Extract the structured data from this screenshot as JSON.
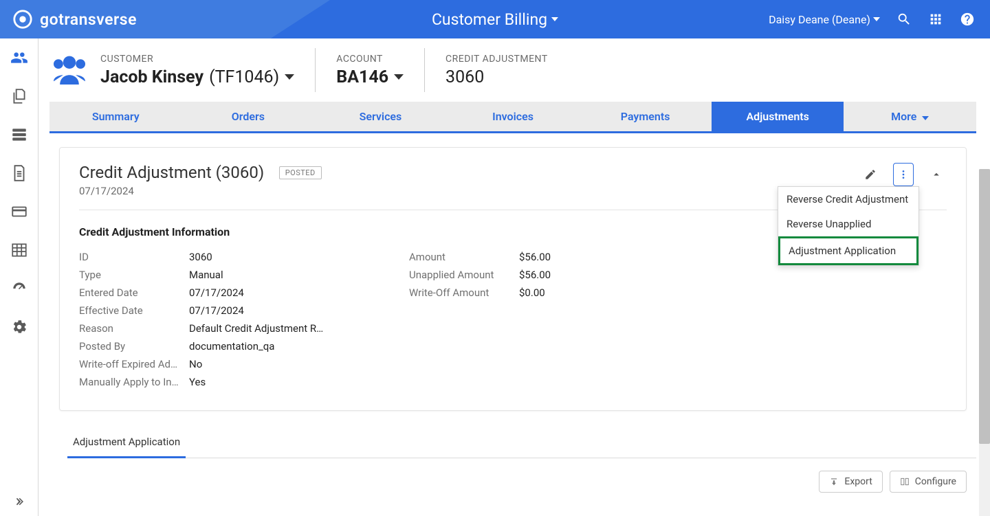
{
  "app": {
    "name": "gotransverse",
    "module": "Customer Billing"
  },
  "user": {
    "display": "Daisy Deane (Deane)"
  },
  "breadcrumb": {
    "customer": {
      "label": "CUSTOMER",
      "name": "Jacob Kinsey",
      "ref": "(TF1046)"
    },
    "account": {
      "label": "ACCOUNT",
      "value": "BA146"
    },
    "credit_adjustment": {
      "label": "CREDIT ADJUSTMENT",
      "value": "3060"
    }
  },
  "tabs": [
    "Summary",
    "Orders",
    "Services",
    "Invoices",
    "Payments",
    "Adjustments",
    "More"
  ],
  "active_tab": "Adjustments",
  "card": {
    "title": "Credit Adjustment (3060)",
    "badge": "POSTED",
    "date": "07/17/2024",
    "section_heading": "Credit Adjustment Information",
    "left": [
      {
        "label": "ID",
        "value": "3060"
      },
      {
        "label": "Type",
        "value": "Manual"
      },
      {
        "label": "Entered Date",
        "value": "07/17/2024"
      },
      {
        "label": "Effective Date",
        "value": "07/17/2024"
      },
      {
        "label": "Reason",
        "value": "Default Credit Adjustment R…"
      },
      {
        "label": "Posted By",
        "value": "documentation_qa"
      },
      {
        "label": "Write-off Expired Ad…",
        "value": "No"
      },
      {
        "label": "Manually Apply to In…",
        "value": "Yes"
      }
    ],
    "right": [
      {
        "label": "Amount",
        "value": "$56.00"
      },
      {
        "label": "Unapplied Amount",
        "value": "$56.00"
      },
      {
        "label": "Write-Off Amount",
        "value": "$0.00"
      }
    ],
    "menu": [
      "Reverse Credit Adjustment",
      "Reverse Unapplied",
      "Adjustment Application"
    ]
  },
  "subtab": "Adjustment Application",
  "buttons": {
    "export": "Export",
    "configure": "Configure"
  }
}
